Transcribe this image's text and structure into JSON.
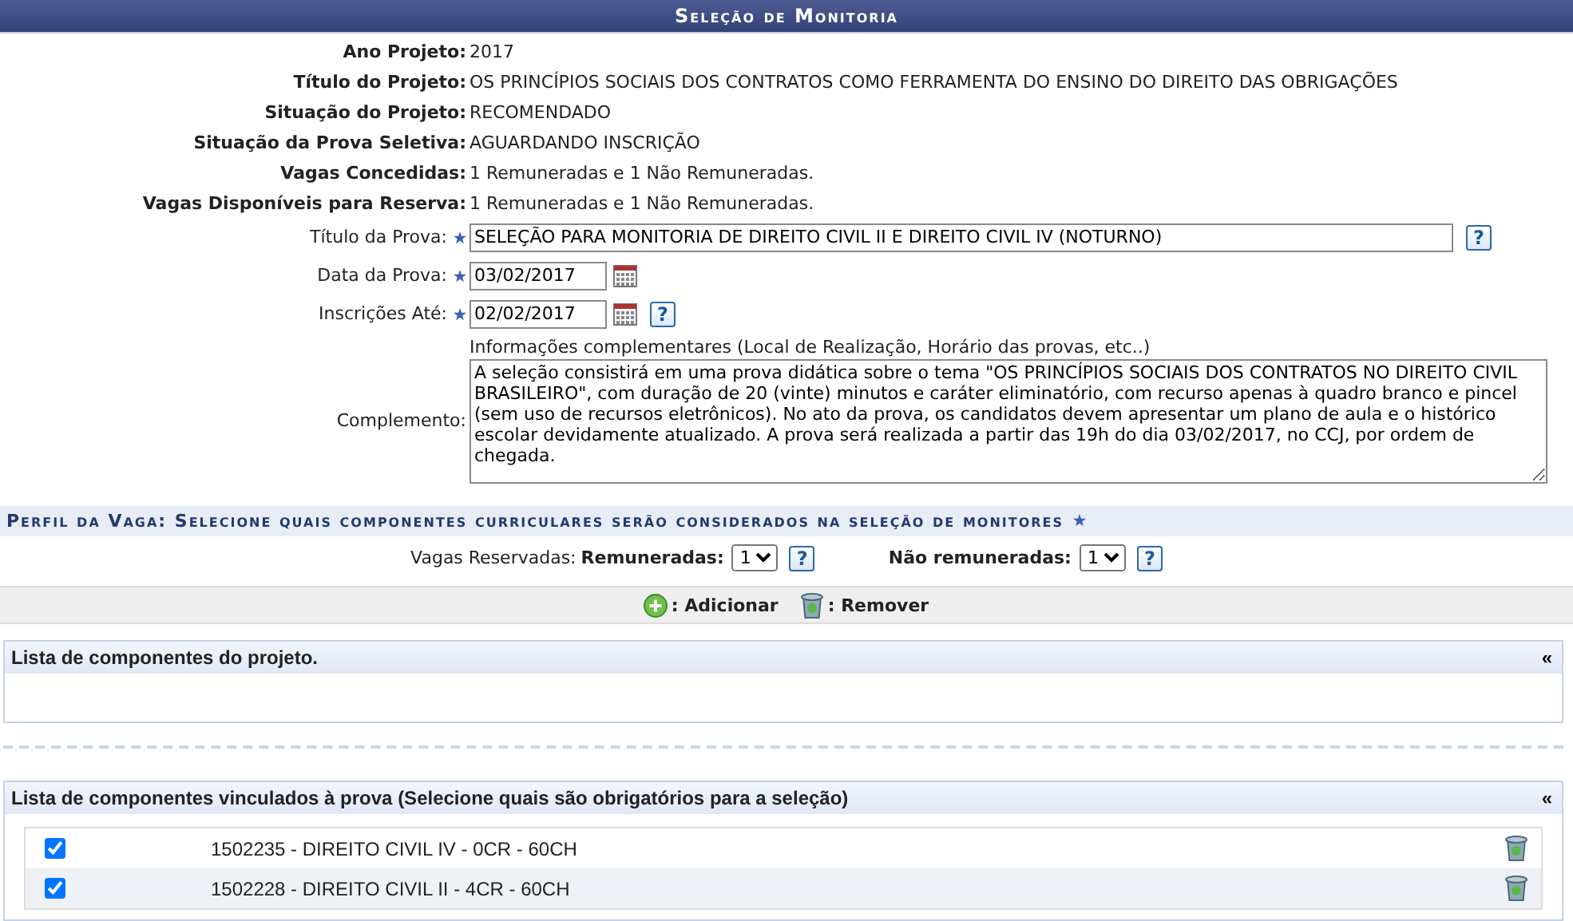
{
  "header": {
    "title": "Seleção de Monitoria"
  },
  "info": [
    {
      "label": "Ano Projeto:",
      "value": "2017"
    },
    {
      "label": "Título do Projeto:",
      "value": "OS PRINCÍPIOS SOCIAIS DOS CONTRATOS COMO FERRAMENTA DO ENSINO DO DIREITO DAS OBRIGAÇÕES"
    },
    {
      "label": "Situação do Projeto:",
      "value": "RECOMENDADO"
    },
    {
      "label": "Situação da Prova Seletiva:",
      "value": "AGUARDANDO INSCRIÇÃO"
    },
    {
      "label": "Vagas Concedidas:",
      "value": "1 Remuneradas e 1 Não Remuneradas."
    },
    {
      "label": "Vagas Disponíveis para Reserva:",
      "value": "1 Remuneradas e 1 Não Remuneradas."
    }
  ],
  "fields": [
    {
      "kind": "text",
      "label": "Título da Prova:",
      "required": true,
      "value": "SELEÇÃO PARA MONITORIA DE DIREITO CIVIL II E DIREITO CIVIL IV (NOTURNO)",
      "help": "?"
    },
    {
      "kind": "date",
      "label": "Data da Prova:",
      "required": true,
      "value": "03/02/2017"
    },
    {
      "kind": "date",
      "label": "Inscrições Até:",
      "required": true,
      "value": "02/02/2017",
      "help": "?"
    }
  ],
  "complemento": {
    "label": "Complemento:",
    "hint": "Informações complementares (Local de Realização, Horário das provas, etc..)",
    "value": "A seleção consistirá em uma prova didática sobre o tema \"OS PRINCÍPIOS SOCIAIS DOS CONTRATOS NO DIREITO CIVIL BRASILEIRO\", com duração de 20 (vinte) minutos e caráter eliminatório, com recurso apenas à quadro branco e pincel (sem uso de recursos eletrônicos). No ato da prova, os candidatos devem apresentar um plano de aula e o histórico escolar devidamente atualizado. A prova será realizada a partir das 19h do dia 03/02/2017, no CCJ, por ordem de chegada."
  },
  "perfil": {
    "title": "Perfil da Vaga: Selecione quais componentes curriculares serão considerados na seleção de monitores",
    "required": true,
    "reserved_label": "Vagas Reservadas:",
    "selects": [
      {
        "label": "Remuneradas:",
        "value": "1",
        "help": "?"
      },
      {
        "label": "Não remuneradas:",
        "value": "1",
        "help": "?"
      }
    ]
  },
  "actions": [
    {
      "kind": "add",
      "label": ": Adicionar"
    },
    {
      "kind": "remove",
      "label": ": Remover"
    }
  ],
  "project_components": {
    "title": "Lista de componentes do projeto.",
    "toggle": "«"
  },
  "exam_components": {
    "title": "Lista de componentes vinculados à prova (Selecione quais são obrigatórios para a seleção)",
    "toggle": "«",
    "rows": [
      {
        "label": "1502235 - DIREITO CIVIL IV - 0CR - 60CH",
        "checked": true
      },
      {
        "label": "1502228 - DIREITO CIVIL II - 4CR - 60CH",
        "checked": true
      }
    ]
  }
}
